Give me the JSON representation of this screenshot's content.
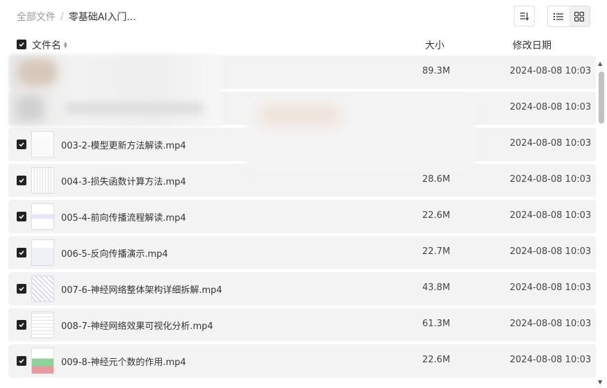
{
  "breadcrumb": {
    "root": "全部文件",
    "separator": "/",
    "current": "零基础AI入门..."
  },
  "toolbar": {
    "sort_icon": "sort-icon",
    "list_view_icon": "list-view-icon",
    "grid_view_icon": "grid-view-icon",
    "active_view": "grid"
  },
  "table": {
    "headers": {
      "name": "文件名",
      "size": "大小",
      "date": "修改日期"
    },
    "rows": [
      {
        "name": "",
        "size": "89.3M",
        "date": "2024-08-08 10:03",
        "checked": false
      },
      {
        "name": "",
        "size": "",
        "date": "2024-08-08 10:03",
        "checked": false
      },
      {
        "name": "003-2-模型更新方法解读.mp4",
        "size": "",
        "date": "2024-08-08 10:03",
        "checked": true
      },
      {
        "name": "004-3-损失函数计算方法.mp4",
        "size": "28.6M",
        "date": "2024-08-08 10:03",
        "checked": true
      },
      {
        "name": "005-4-前向传播流程解读.mp4",
        "size": "22.6M",
        "date": "2024-08-08 10:03",
        "checked": true
      },
      {
        "name": "006-5-反向传播演示.mp4",
        "size": "22.7M",
        "date": "2024-08-08 10:03",
        "checked": true
      },
      {
        "name": "007-6-神经网络整体架构详细拆解.mp4",
        "size": "43.8M",
        "date": "2024-08-08 10:03",
        "checked": true
      },
      {
        "name": "008-7-神经网络效果可视化分析.mp4",
        "size": "61.3M",
        "date": "2024-08-08 10:03",
        "checked": true
      },
      {
        "name": "009-8-神经元个数的作用.mp4",
        "size": "22.6M",
        "date": "2024-08-08 10:03",
        "checked": true
      }
    ]
  }
}
